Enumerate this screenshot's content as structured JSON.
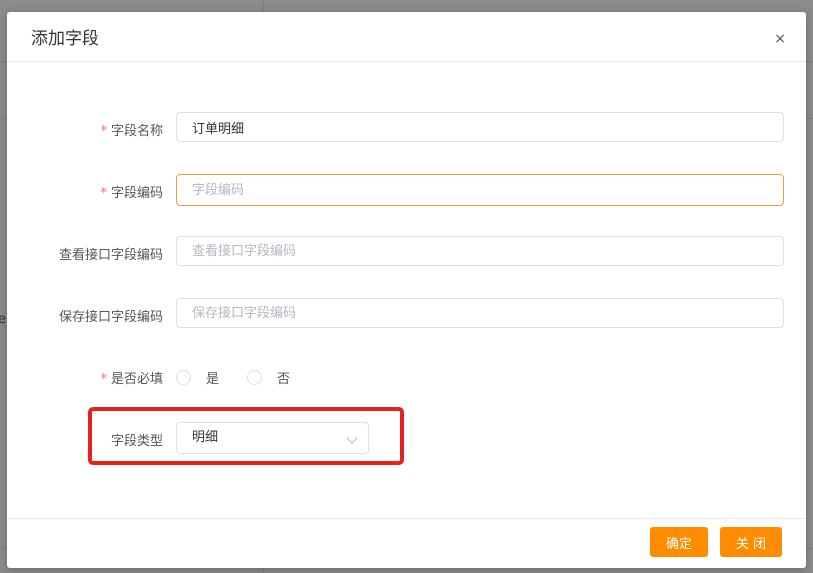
{
  "dialog": {
    "title": "添加字段",
    "close_symbol": "×"
  },
  "form": {
    "field_name": {
      "label": "字段名称",
      "required": "*",
      "value": "订单明细"
    },
    "field_code": {
      "label": "字段编码",
      "required": "*",
      "placeholder": "字段编码"
    },
    "view_api_code": {
      "label": "查看接口字段编码",
      "placeholder": "查看接口字段编码"
    },
    "save_api_code": {
      "label": "保存接口字段编码",
      "placeholder": "保存接口字段编码"
    },
    "is_required": {
      "label": "是否必填",
      "required": "*",
      "option_yes": "是",
      "option_no": "否"
    },
    "field_type": {
      "label": "字段类型",
      "value": "明细"
    }
  },
  "footer": {
    "confirm_label": "确定",
    "close_label": "关 闭"
  },
  "background": {
    "partial_text": "e"
  },
  "colors": {
    "accent": "#ff8c00",
    "focus_border": "#e6a23c",
    "required": "#f56c6c",
    "highlight": "#e8211f"
  }
}
